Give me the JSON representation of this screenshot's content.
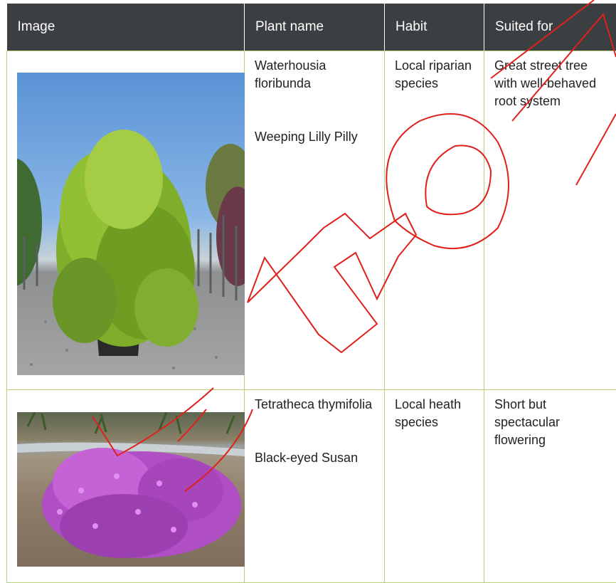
{
  "headers": [
    "Image",
    "Plant name",
    "Habit",
    "Suited for"
  ],
  "rows": [
    {
      "botanical_name": "Waterhousia floribunda",
      "common_name": "Weeping Lilly Pilly",
      "habit": "Local riparian species",
      "suited_for": "Great street tree with well-behaved root system",
      "image_alt": "Weeping Lilly Pilly tree in a pot"
    },
    {
      "botanical_name": "Tetratheca thymifolia",
      "common_name": "Black-eyed Susan",
      "habit": "Local heath species",
      "suited_for": "Short but spectacular flowering",
      "image_alt": "Flowering Black-eyed Susan shrub"
    }
  ],
  "colors": {
    "header_bg": "#3c3f42",
    "header_text": "#ffffff",
    "border": "#b9cf7f",
    "watermark": "#e0201b"
  },
  "watermark_text": "Draft"
}
